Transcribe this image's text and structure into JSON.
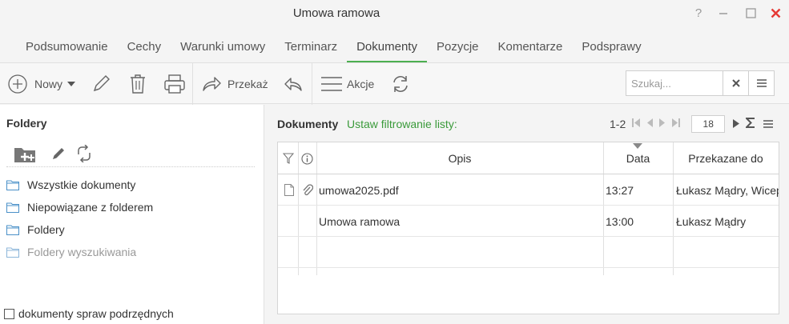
{
  "window": {
    "title": "Umowa ramowa",
    "help": "?",
    "minimize": "—",
    "maximize": "☐",
    "close": "✕"
  },
  "tabs": [
    {
      "label": "Podsumowanie"
    },
    {
      "label": "Cechy"
    },
    {
      "label": "Warunki umowy"
    },
    {
      "label": "Terminarz"
    },
    {
      "label": "Dokumenty",
      "active": true
    },
    {
      "label": "Pozycje"
    },
    {
      "label": "Komentarze"
    },
    {
      "label": "Podsprawy"
    }
  ],
  "toolbar": {
    "new_label": "Nowy",
    "forward_label": "Przekaż",
    "actions_label": "Akcje",
    "search_placeholder": "Szukaj..."
  },
  "folders": {
    "title": "Foldery",
    "items": [
      {
        "label": "Wszystkie dokumenty"
      },
      {
        "label": "Niepowiązane z folderem"
      },
      {
        "label": "Foldery"
      },
      {
        "label": "Foldery wyszukiwania",
        "dim": true
      }
    ],
    "subcases_label": "dokumenty spraw podrzędnych"
  },
  "documents": {
    "title": "Dokumenty",
    "filter_link": "Ustaw filtrowanie listy:",
    "range": "1-2",
    "page_size": "18",
    "columns": {
      "opis": "Opis",
      "data": "Data",
      "przekazane": "Przekazane do"
    },
    "rows": [
      {
        "opis": "umowa2025.pdf",
        "data": "13:27",
        "przekazane": "Łukasz Mądry, Wicep",
        "has_file": true
      },
      {
        "opis": "Umowa ramowa",
        "data": "13:00",
        "przekazane": "Łukasz Mądry",
        "has_file": false
      }
    ]
  },
  "colors": {
    "accent": "#4caf50",
    "link": "#3a9a3a",
    "close": "#e53935"
  }
}
